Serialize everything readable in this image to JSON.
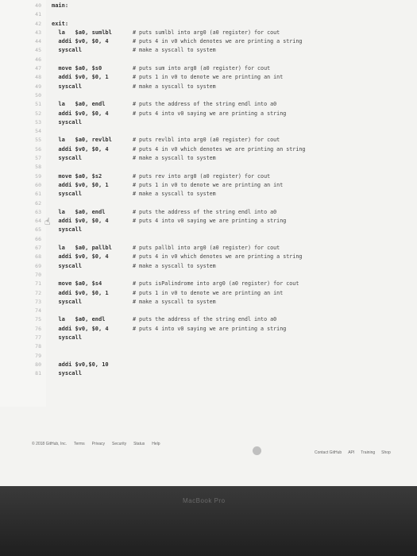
{
  "editor": {
    "lines": [
      {
        "n": "40",
        "code": "main:",
        "comment": ""
      },
      {
        "n": "41",
        "code": "",
        "comment": ""
      },
      {
        "n": "42",
        "code": "exit:",
        "comment": ""
      },
      {
        "n": "43",
        "code": "  la   $a0, sumlbl",
        "comment": "# puts sumlbl into arg0 (a0 register) for cout"
      },
      {
        "n": "44",
        "code": "  addi $v0, $0, 4",
        "comment": "# puts 4 in v0 which denotes we are printing a string"
      },
      {
        "n": "45",
        "code": "  syscall",
        "comment": "# make a syscall to system"
      },
      {
        "n": "46",
        "code": "",
        "comment": ""
      },
      {
        "n": "47",
        "code": "  move $a0, $s0",
        "comment": "# puts sum into arg0 (a0 register) for cout"
      },
      {
        "n": "48",
        "code": "  addi $v0, $0, 1",
        "comment": "# puts 1 in v0 to denote we are printing an int"
      },
      {
        "n": "49",
        "code": "  syscall",
        "comment": "# make a syscall to system"
      },
      {
        "n": "50",
        "code": "",
        "comment": ""
      },
      {
        "n": "51",
        "code": "  la   $a0, endl",
        "comment": "# puts the address of the string endl into a0"
      },
      {
        "n": "52",
        "code": "  addi $v0, $0, 4",
        "comment": "# puts 4 into v0 saying we are printing a string"
      },
      {
        "n": "53",
        "code": "  syscall",
        "comment": ""
      },
      {
        "n": "54",
        "code": "",
        "comment": ""
      },
      {
        "n": "55",
        "code": "  la   $a0, revlbl",
        "comment": "# puts revlbl into arg0 (a0 register) for cout"
      },
      {
        "n": "56",
        "code": "  addi $v0, $0, 4",
        "comment": "# puts 4 in v0 which denotes we are printing an string"
      },
      {
        "n": "57",
        "code": "  syscall",
        "comment": "# make a syscall to system"
      },
      {
        "n": "58",
        "code": "",
        "comment": ""
      },
      {
        "n": "59",
        "code": "  move $a0, $s2",
        "comment": "# puts rev into arg0 (a0 register) for cout"
      },
      {
        "n": "60",
        "code": "  addi $v0, $0, 1",
        "comment": "# puts 1 in v0 to denote we are printing an int"
      },
      {
        "n": "61",
        "code": "  syscall",
        "comment": "# make a syscall to system"
      },
      {
        "n": "62",
        "code": "",
        "comment": ""
      },
      {
        "n": "63",
        "code": "  la   $a0, endl",
        "comment": "# puts the address of the string endl into a0"
      },
      {
        "n": "64",
        "code": "  addi $v0, $0, 4",
        "comment": "# puts 4 into v0 saying we are printing a string"
      },
      {
        "n": "65",
        "code": "  syscall",
        "comment": ""
      },
      {
        "n": "66",
        "code": "",
        "comment": ""
      },
      {
        "n": "67",
        "code": "  la   $a0, pallbl",
        "comment": "# puts pallbl into arg0 (a0 register) for cout"
      },
      {
        "n": "68",
        "code": "  addi $v0, $0, 4",
        "comment": "# puts 4 in v0 which denotes we are printing a string"
      },
      {
        "n": "69",
        "code": "  syscall",
        "comment": "# make a syscall to system"
      },
      {
        "n": "70",
        "code": "",
        "comment": ""
      },
      {
        "n": "71",
        "code": "  move $a0, $s4",
        "comment": "# puts isPalindrome into arg0 (a0 register) for cout"
      },
      {
        "n": "72",
        "code": "  addi $v0, $0, 1",
        "comment": "# puts 1 in v0 to denote we are printing an int"
      },
      {
        "n": "73",
        "code": "  syscall",
        "comment": "# make a syscall to system"
      },
      {
        "n": "74",
        "code": "",
        "comment": ""
      },
      {
        "n": "75",
        "code": "  la   $a0, endl",
        "comment": "# puts the address of the string endl into a0"
      },
      {
        "n": "76",
        "code": "  addi $v0, $0, 4",
        "comment": "# puts 4 into v0 saying we are printing a string"
      },
      {
        "n": "77",
        "code": "  syscall",
        "comment": ""
      },
      {
        "n": "78",
        "code": "",
        "comment": ""
      },
      {
        "n": "79",
        "code": "",
        "comment": ""
      },
      {
        "n": "80",
        "code": "  addi $v0,$0, 10",
        "comment": ""
      },
      {
        "n": "81",
        "code": "  syscall",
        "comment": ""
      }
    ]
  },
  "footer": {
    "copyright": "© 2018 GitHub, Inc.",
    "links_left": [
      "Terms",
      "Privacy",
      "Security",
      "Status",
      "Help"
    ],
    "links_right": [
      "Contact GitHub",
      "API",
      "Training",
      "Shop"
    ]
  },
  "bezel": {
    "label": "MacBook Pro"
  }
}
